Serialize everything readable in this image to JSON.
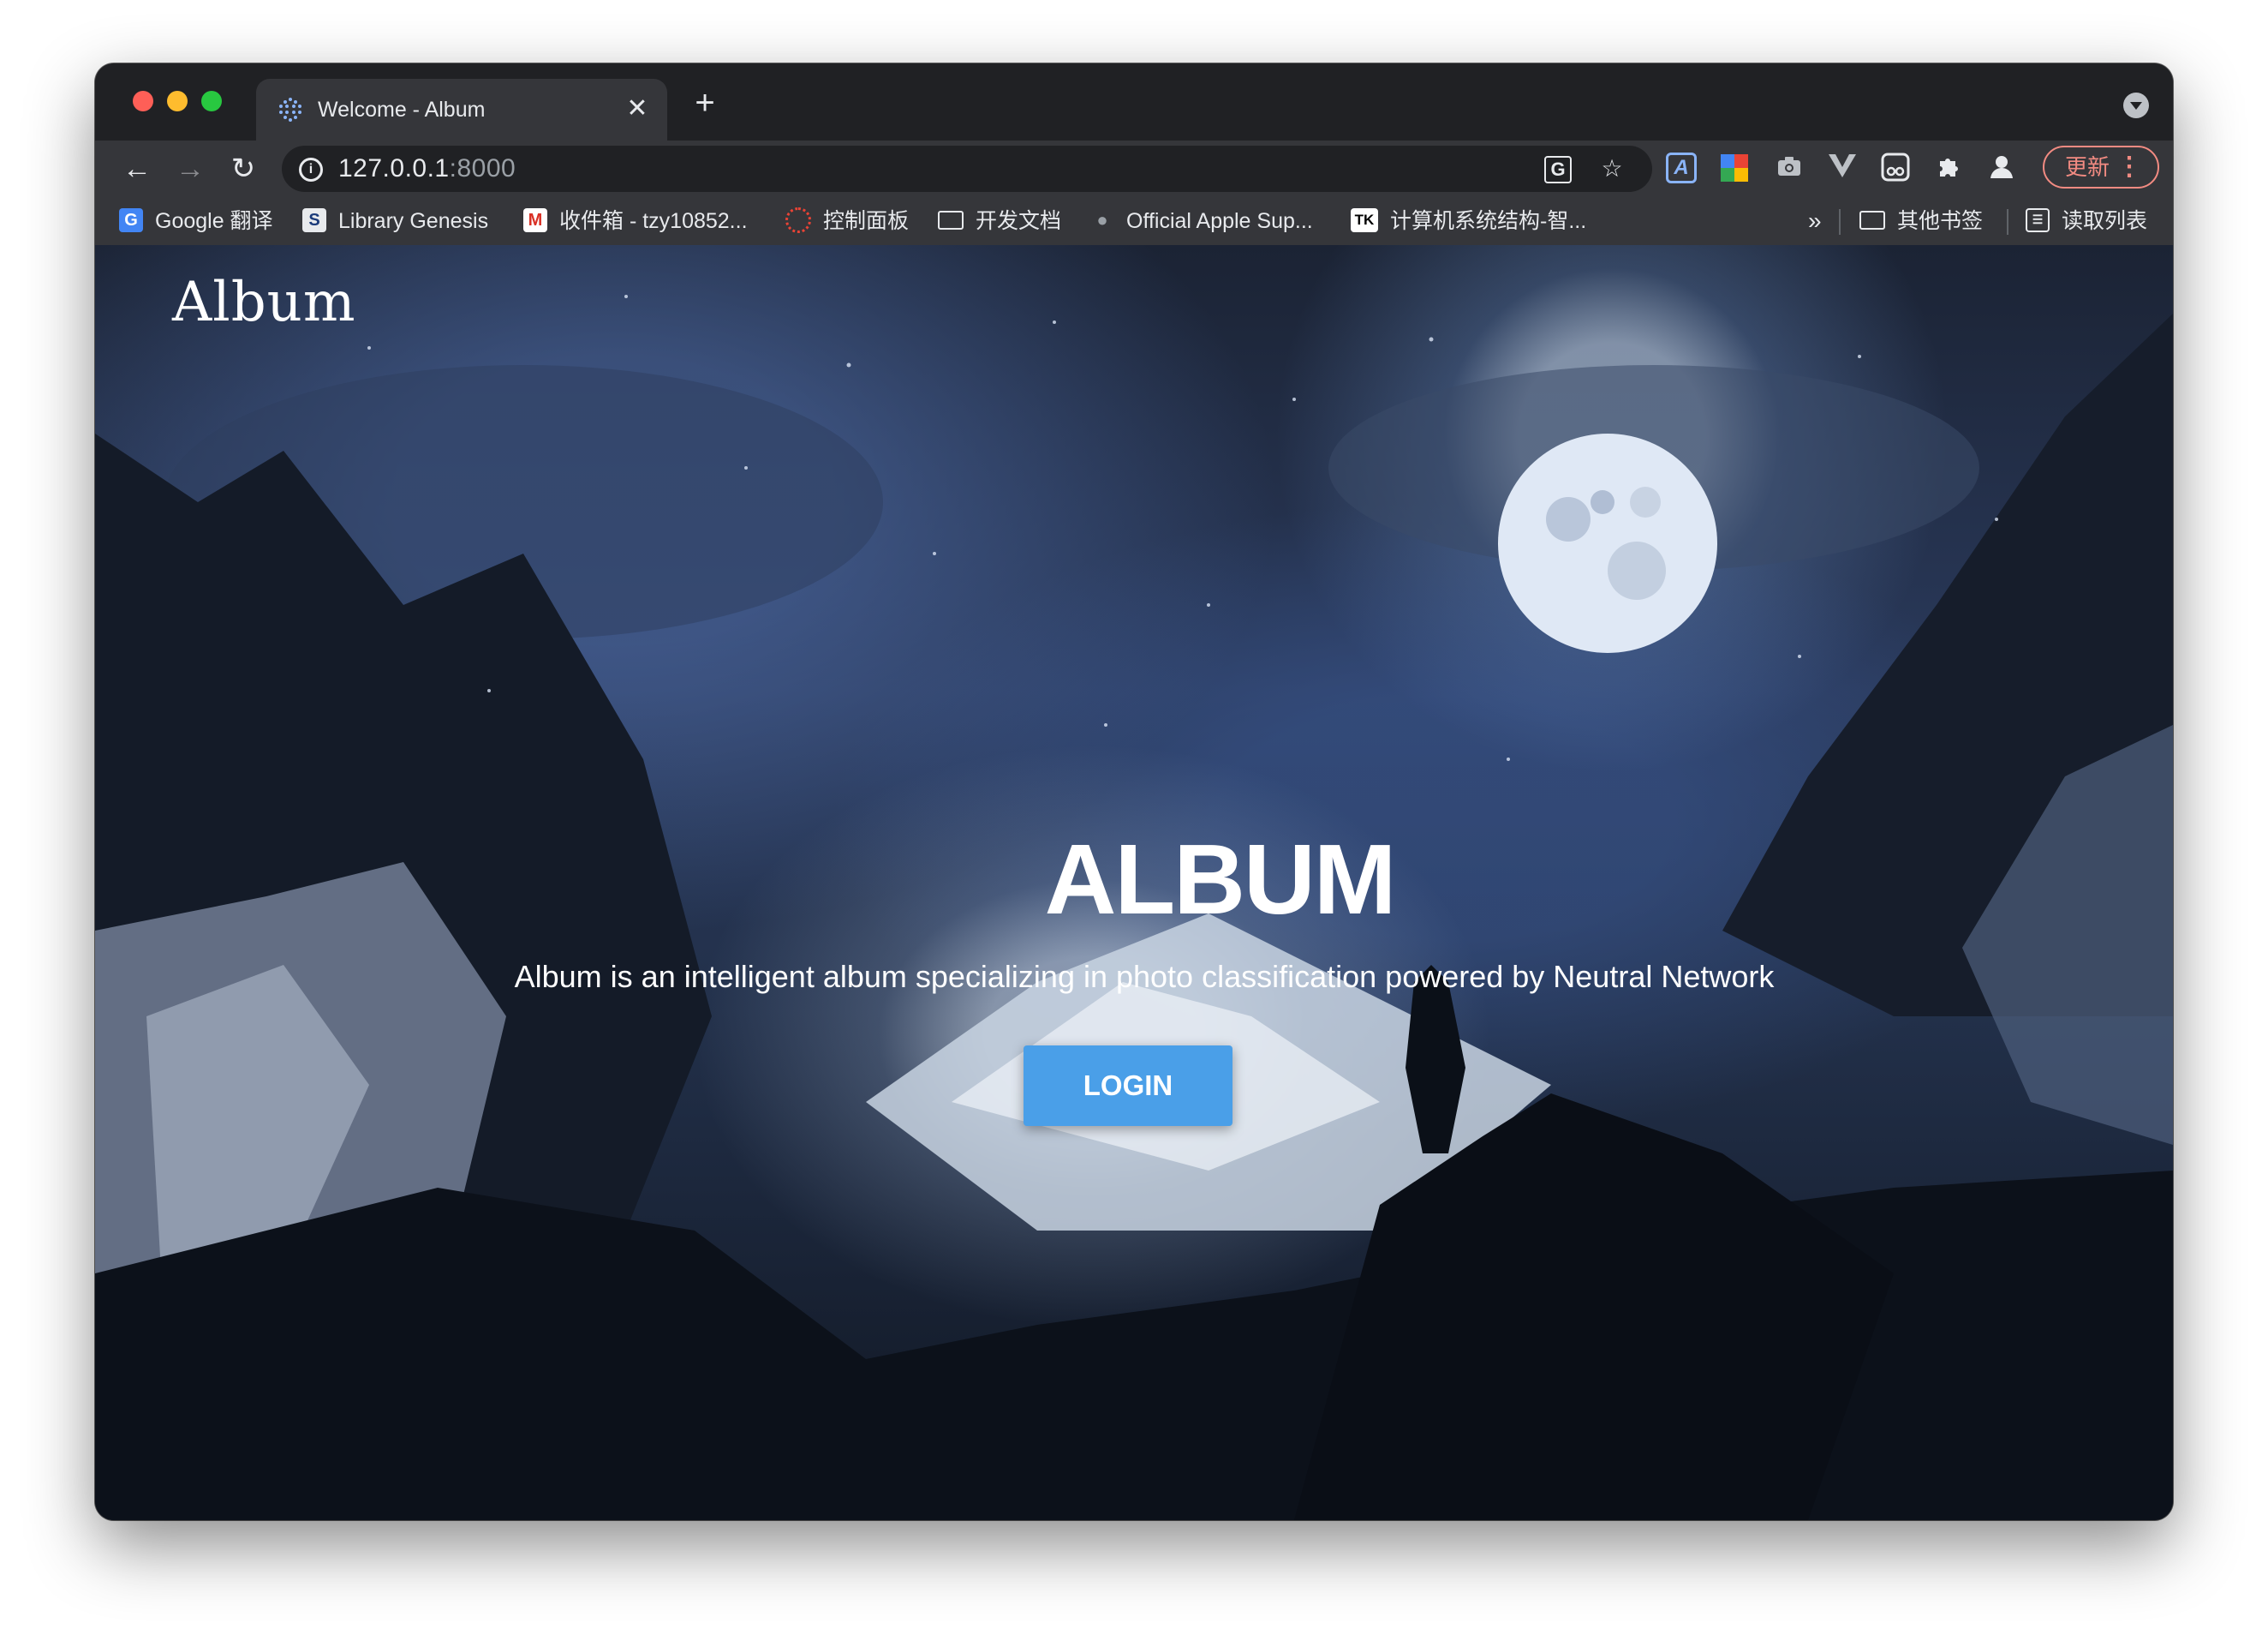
{
  "browser": {
    "tab": {
      "title": "Welcome - Album",
      "close_glyph": "✕",
      "favicon": "dots-favicon-icon"
    },
    "new_tab_glyph": "+",
    "toolbar": {
      "back_glyph": "←",
      "forward_glyph": "→",
      "reload_glyph": "↻",
      "url_host": "127.0.0.1",
      "url_port": ":8000",
      "translate_glyph": "G",
      "bookmark_star_glyph": "☆",
      "update_label": "更新",
      "menu_glyph": "⋮"
    },
    "bookmarks": {
      "items": [
        {
          "label": "Google 翻译",
          "icon": "google-translate-icon"
        },
        {
          "label": "Library Genesis",
          "icon": "library-genesis-icon"
        },
        {
          "label": "收件箱 - tzy10852...",
          "icon": "gmail-icon"
        },
        {
          "label": "控制面板",
          "icon": "control-panel-icon"
        },
        {
          "label": "开发文档",
          "icon": "folder-icon"
        },
        {
          "label": "Official Apple Sup...",
          "icon": "apple-icon"
        },
        {
          "label": "计算机系统结构-智...",
          "icon": "tk-icon"
        }
      ],
      "overflow_glyph": "»",
      "other_bookmarks": "其他书签",
      "reading_list": "读取列表"
    },
    "colors": {
      "update_accent": "#f28b82",
      "chrome_bg": "#202124",
      "toolbar_bg": "#35363a"
    }
  },
  "page": {
    "brand": "Album",
    "hero": {
      "title": "ALBUM",
      "subtitle": "Album is an intelligent album specializing in photo classification powered by Neutral Network"
    },
    "login_label": "LOGIN",
    "colors": {
      "login_button": "#4a9fe8"
    }
  }
}
